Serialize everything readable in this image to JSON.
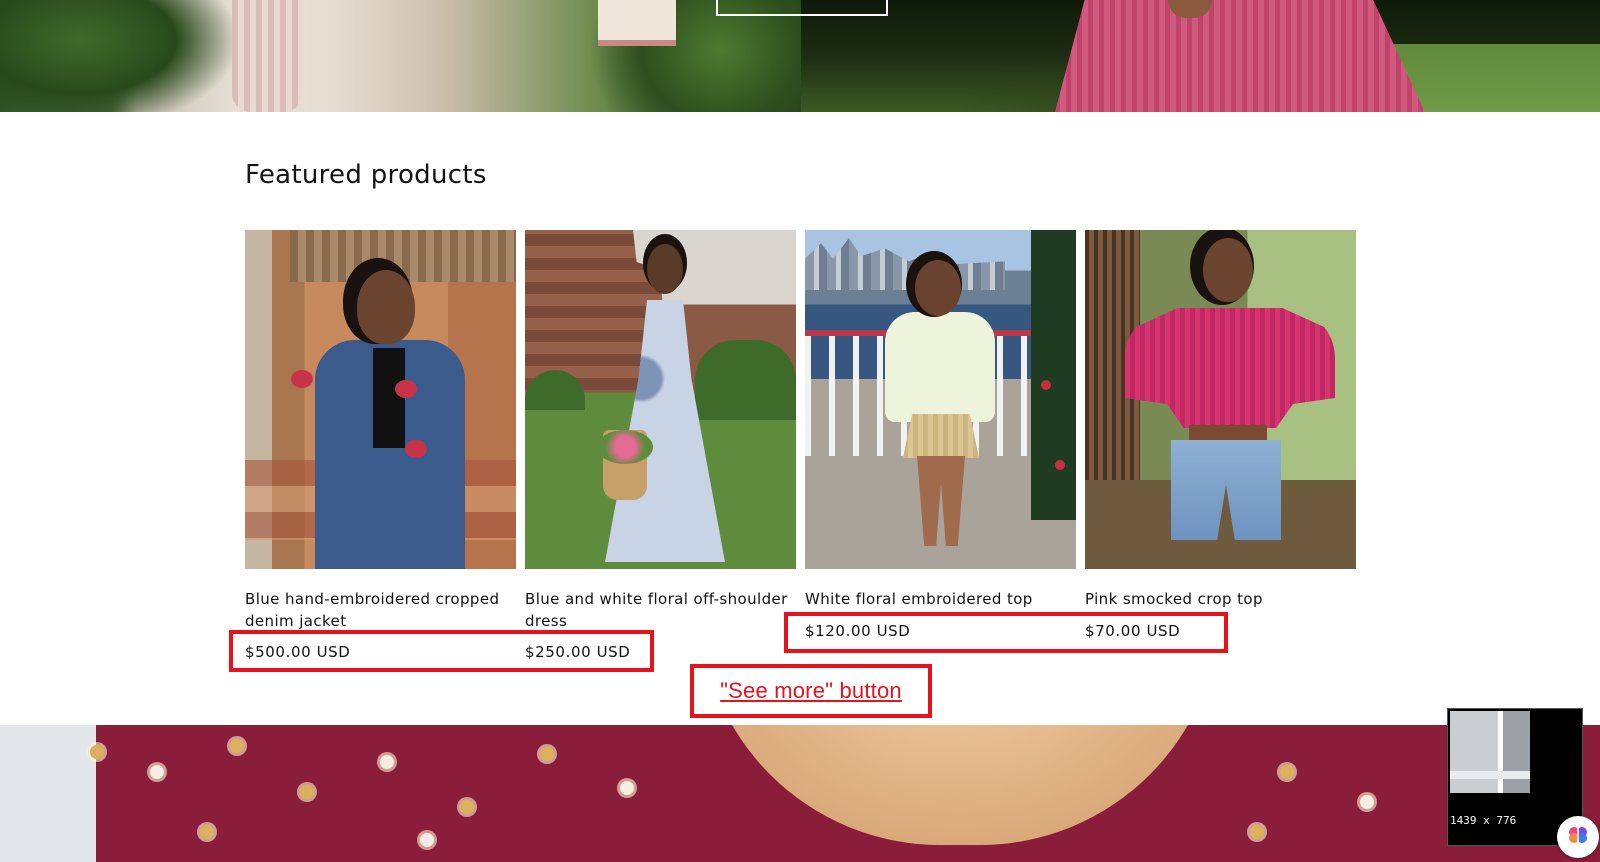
{
  "section": {
    "title": "Featured products"
  },
  "products": [
    {
      "title": "Blue hand-embroidered cropped denim jacket",
      "price": "$500.00 USD"
    },
    {
      "title": "Blue and white floral off-shoulder dress",
      "price": "$250.00 USD"
    },
    {
      "title": "White floral embroidered top",
      "price": "$120.00 USD"
    },
    {
      "title": "Pink smocked crop top",
      "price": "$70.00 USD"
    }
  ],
  "annotation": {
    "see_more_label": "\"See more\" button",
    "color": "#e8121a"
  },
  "preview_widget": {
    "dimensions": "1439  x  776"
  },
  "icons": {
    "assistant": "brain-icon"
  }
}
